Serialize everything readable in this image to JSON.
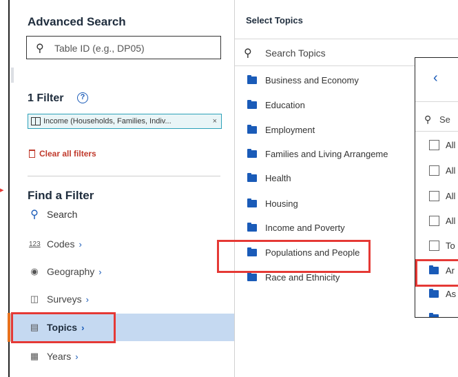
{
  "left": {
    "title": "Advanced Search",
    "table_id_placeholder": "Table ID (e.g., DP05)",
    "filter_count": "1 Filter",
    "help_glyph": "?",
    "chip_label": "Income (Households, Families, Indiv...",
    "chip_close": "×",
    "clear_filters": "Clear all filters",
    "find_title": "Find a Filter",
    "nav": [
      {
        "label": "Search",
        "icon": "search-icon"
      },
      {
        "label": "Codes",
        "icon": "codes-icon",
        "glyph": "123"
      },
      {
        "label": "Geography",
        "icon": "location-pin-icon"
      },
      {
        "label": "Surveys",
        "icon": "survey-icon"
      },
      {
        "label": "Topics",
        "icon": "book-icon"
      },
      {
        "label": "Years",
        "icon": "calendar-icon"
      }
    ],
    "chevron": "›"
  },
  "topics": {
    "header": "Select Topics",
    "search_placeholder": "Search Topics",
    "items": [
      "Business and Economy",
      "Education",
      "Employment",
      "Families and Living Arrangeme",
      "Health",
      "Housing",
      "Income and Poverty",
      "Populations and People",
      "Race and Ethnicity"
    ]
  },
  "subtopics": {
    "back": "‹",
    "search_placeholder": "Se",
    "checkbox_items": [
      "All",
      "All",
      "All",
      "All",
      "To"
    ],
    "folder_items": [
      "Ar",
      "As"
    ]
  },
  "colors": {
    "accent_blue": "#1a5bb8",
    "highlight_red": "#e53935",
    "selected_bg": "#c5d9f1",
    "chip_border": "#2aa0b8"
  }
}
